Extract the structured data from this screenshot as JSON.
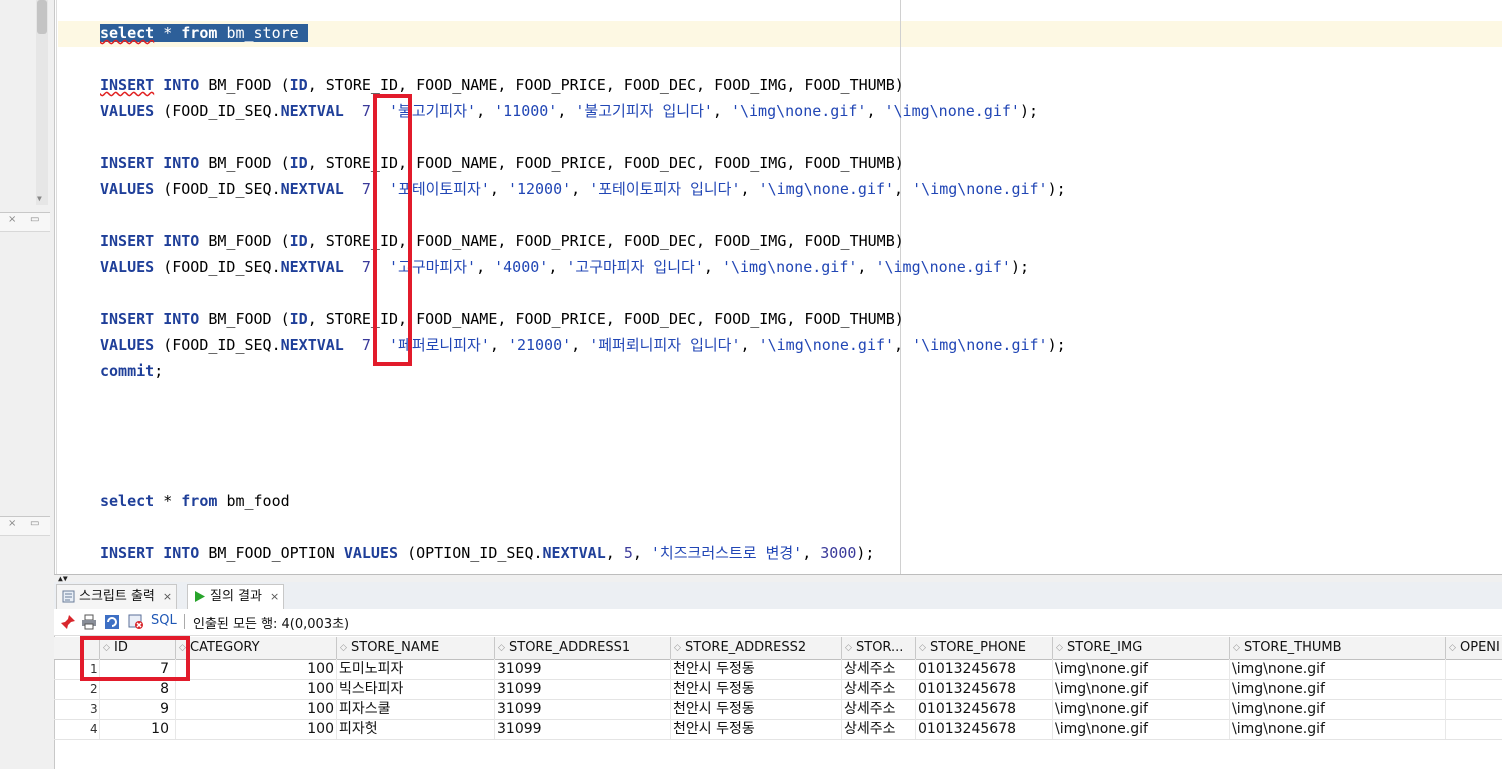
{
  "editor": {
    "lines": {
      "l1": {
        "kw1": "select",
        "op": "*",
        "kw2": "from",
        "rest": "bm_store"
      },
      "ins": {
        "kw_insert": "INSERT",
        "kw_into": "INTO",
        "table": "BM_FOOD",
        "open": "(",
        "col_id": "ID",
        "cols": ", STORE_ID, FOOD_NAME, FOOD_PRICE, FOOD_DEC, FOOD_IMG, FOOD_THUMB)"
      },
      "values_kw": "VALUES",
      "seq_prefix": "(FOOD_ID_SEQ.",
      "nextval": "NEXTVAL",
      "stmts": [
        {
          "num": "7",
          "name": "'불고기피자'",
          "price": "'11000'",
          "desc": "'불고기피자 입니다'",
          "img": "'\\img\\none.gif'",
          "thumb": "'\\img\\none.gif'"
        },
        {
          "num": "7",
          "name": "'포테이토피자'",
          "price": "'12000'",
          "desc": "'포테이토피자 입니다'",
          "img": "'\\img\\none.gif'",
          "thumb": "'\\img\\none.gif'"
        },
        {
          "num": "7",
          "name": "'고구마피자'",
          "price": "'4000'",
          "desc": "'고구마피자 입니다'",
          "img": "'\\img\\none.gif'",
          "thumb": "'\\img\\none.gif'"
        },
        {
          "num": "7",
          "name": "'페퍼로니피자'",
          "price": "'21000'",
          "desc": "'페퍼뢰니피자 입니다'",
          "img": "'\\img\\none.gif'",
          "thumb": "'\\img\\none.gif'"
        }
      ],
      "commit": "commit",
      "l_food": {
        "kw1": "select",
        "op": "*",
        "kw2": "from",
        "rest": "bm_food"
      },
      "opt": {
        "kw_insert": "INSERT",
        "kw_into": "INTO",
        "table": "BM_FOOD_OPTION",
        "kw_values": "VALUES",
        "prefix": "(OPTION_ID_SEQ.",
        "nextval": "NEXTVAL",
        "num": "5",
        "str": "'치즈크러스트로 변경'",
        "price": "3000",
        "end": ");"
      }
    }
  },
  "tabs": [
    {
      "label": "스크립트 출력",
      "close": "×",
      "active": false
    },
    {
      "label": "질의 결과",
      "close": "×",
      "active": true
    }
  ],
  "toolbar": {
    "sql_label": "SQL",
    "status": "인출된 모든 행: 4(0,003초)"
  },
  "grid": {
    "columns": [
      "ID",
      "CATEGORY",
      "STORE_NAME",
      "STORE_ADDRESS1",
      "STORE_ADDRESS2",
      "STOR...",
      "STORE_PHONE",
      "STORE_IMG",
      "STORE_THUMB",
      "OPENI"
    ],
    "rows": [
      {
        "n": "1",
        "id": "7",
        "category": "100",
        "name": "도미노피자",
        "addr1": "31099",
        "addr2": "천안시 두정동",
        "addr3": "상세주소",
        "phone": "01013245678",
        "img": "\\img\\none.gif",
        "thumb": "\\img\\none.gif"
      },
      {
        "n": "2",
        "id": "8",
        "category": "100",
        "name": "빅스타피자",
        "addr1": "31099",
        "addr2": "천안시 두정동",
        "addr3": "상세주소",
        "phone": "01013245678",
        "img": "\\img\\none.gif",
        "thumb": "\\img\\none.gif"
      },
      {
        "n": "3",
        "id": "9",
        "category": "100",
        "name": "피자스쿨",
        "addr1": "31099",
        "addr2": "천안시 두정동",
        "addr3": "상세주소",
        "phone": "01013245678",
        "img": "\\img\\none.gif",
        "thumb": "\\img\\none.gif"
      },
      {
        "n": "4",
        "id": "10",
        "category": "100",
        "name": "피자헛",
        "addr1": "31099",
        "addr2": "천안시 두정동",
        "addr3": "상세주소",
        "phone": "01013245678",
        "img": "\\img\\none.gif",
        "thumb": "\\img\\none.gif"
      }
    ]
  },
  "colors": {
    "highlight_box": "#e21b2b",
    "selection": "#2d5f99",
    "keyword": "#1f3f99"
  }
}
